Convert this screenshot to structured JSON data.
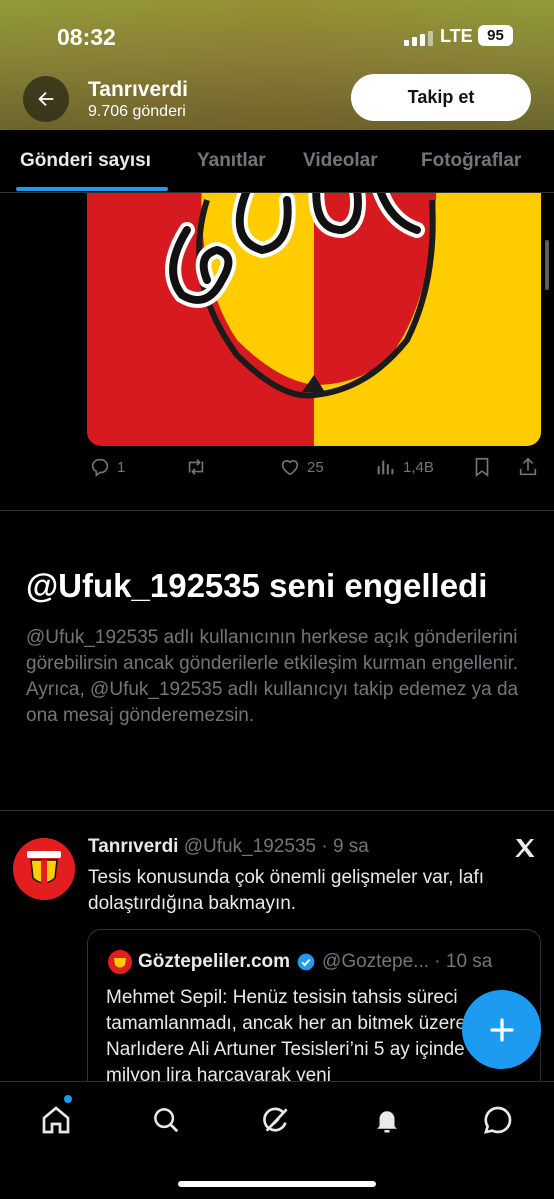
{
  "status_bar": {
    "time": "08:32",
    "network": "LTE",
    "battery": "95"
  },
  "profile": {
    "name": "Tanrıverdi",
    "post_count": "9.706 gönderi",
    "follow_label": "Takip et"
  },
  "tabs": [
    {
      "label": "Gönderi sayısı",
      "active": true
    },
    {
      "label": "Yanıtlar",
      "active": false
    },
    {
      "label": "Videolar",
      "active": false
    },
    {
      "label": "Fotoğraflar",
      "active": false
    }
  ],
  "post_actions": {
    "replies": "1",
    "reposts": "",
    "likes": "25",
    "views": "1,4B"
  },
  "blocked_notice": {
    "title": "@Ufuk_192535 seni engelledi",
    "text": "@Ufuk_192535 adlı kullanıcının herkese açık gönderilerini görebilirsin ancak gönderilerle etkileşim kurman engellenir. Ayrıca, @Ufuk_192535 adlı kullanıcıyı takip edemez ya da ona mesaj gönderemezsin."
  },
  "tweet": {
    "name": "Tanrıverdi",
    "meta": "@Ufuk_192535 · 9 sa",
    "text": "Tesis konusunda çok önemli gelişmeler var, lafı dolaştırdığına bakmayın.",
    "avatar_text": "GÖZTEPE"
  },
  "quote": {
    "name": "Göztepeliler.com",
    "meta": "@Goztepe... · 10 sa",
    "text": "Mehmet Sepil: Henüz tesisin tahsis süreci tamamlanmadı, ancak her an bitmek üzere. Narlıdere Ali Artuner Tesisleri’ni 5 ay içinde 30-40 milyon lira harcayarak yeni"
  },
  "colors": {
    "accent": "#1d9bf0",
    "background": "#000000",
    "muted": "#71767b",
    "text": "#e7e9ea"
  },
  "icons": {
    "back": "arrow-left-icon",
    "reply": "reply-icon",
    "repost": "repost-icon",
    "like": "heart-icon",
    "views": "views-icon",
    "bookmark": "bookmark-icon",
    "share": "share-icon",
    "compose": "plus-icon",
    "home": "home-icon",
    "search": "search-icon",
    "grok": "grok-icon",
    "notifications": "bell-icon",
    "messages": "message-icon"
  }
}
